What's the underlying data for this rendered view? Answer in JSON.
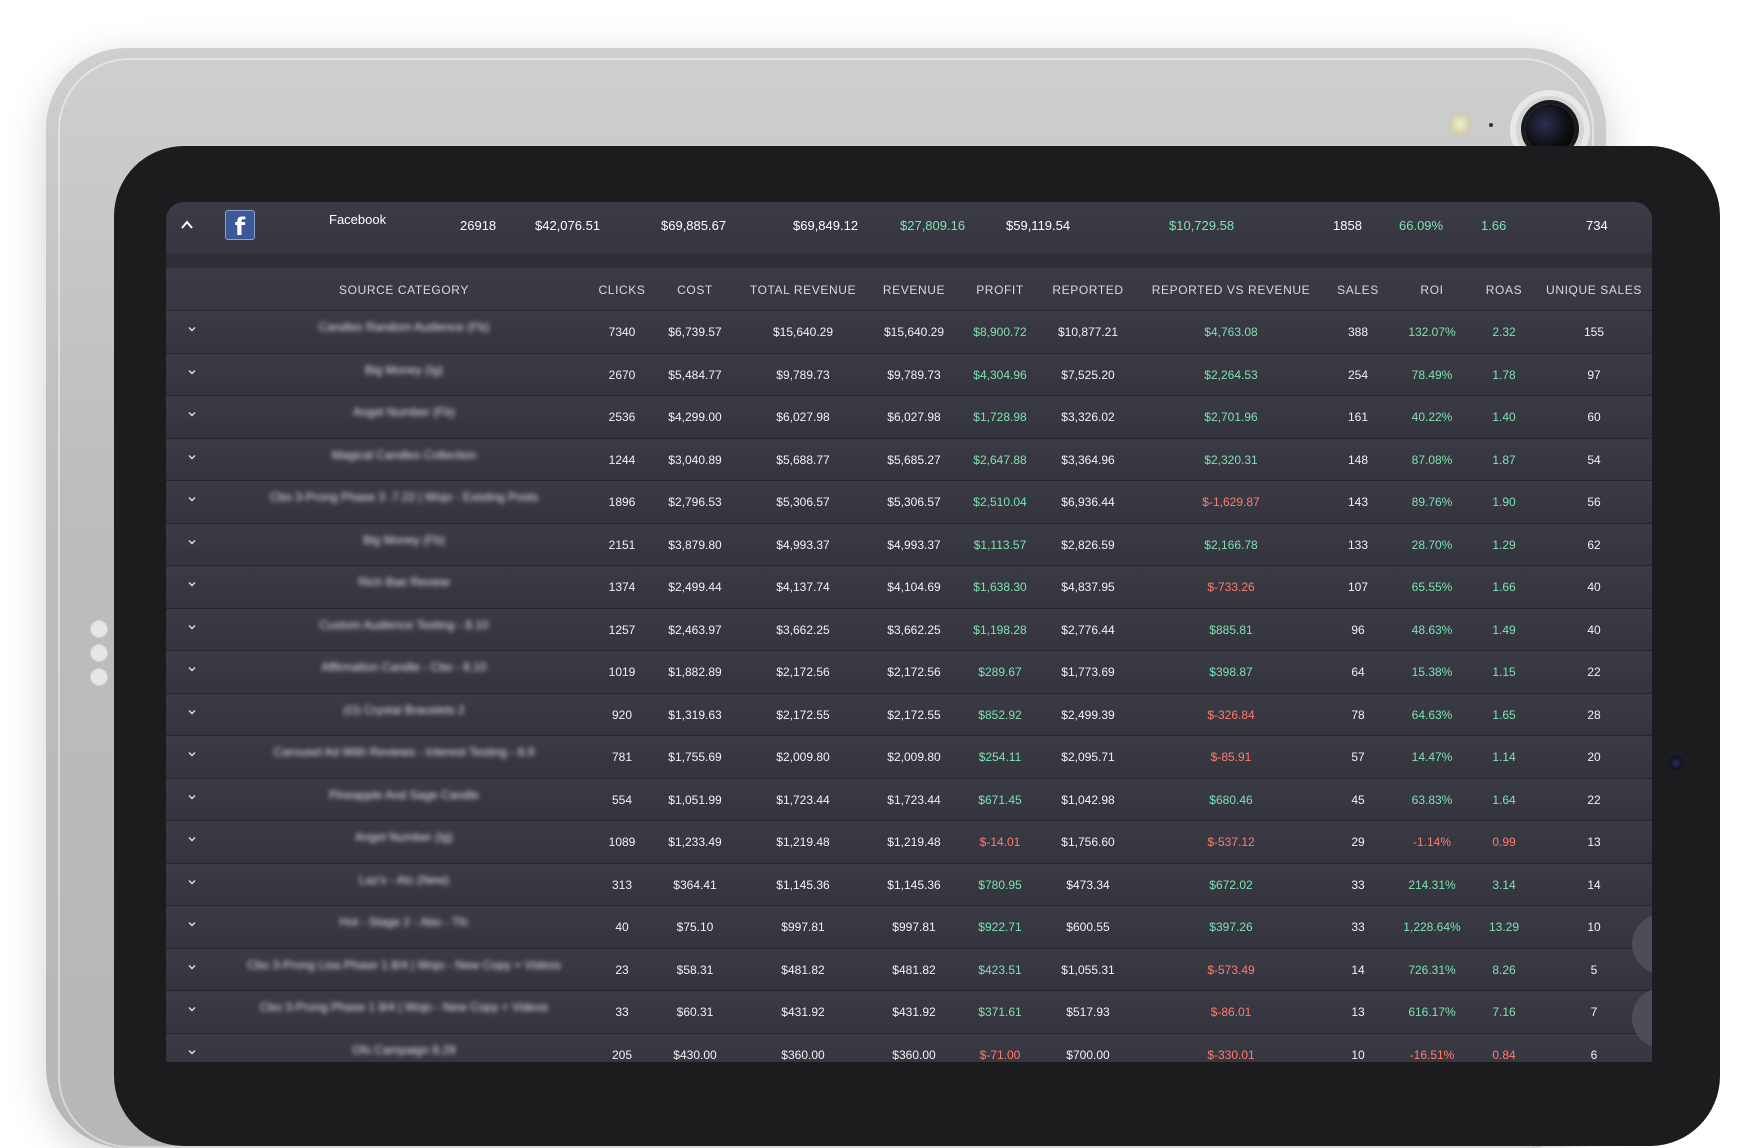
{
  "summary": {
    "source": "Facebook",
    "clicks": "26918",
    "cost": "$42,076.51",
    "total_revenue": "$69,885.67",
    "revenue": "$69,849.12",
    "profit": "$27,809.16",
    "reported": "$59,119.54",
    "reported_vs_revenue": "$10,729.58",
    "sales": "1858",
    "roi": "66.09%",
    "roas": "1.66",
    "unique_sales": "734"
  },
  "columns": {
    "source_category": "SOURCE CATEGORY",
    "clicks": "CLICKS",
    "cost": "COST",
    "total_revenue": "TOTAL REVENUE",
    "revenue": "REVENUE",
    "profit": "PROFIT",
    "reported": "REPORTED",
    "reported_vs_revenue": "REPORTED VS REVENUE",
    "sales": "SALES",
    "roi": "ROI",
    "roas": "ROAS",
    "unique_sales": "UNIQUE SALES"
  },
  "rows": [
    {
      "name": "Candles Random Audience (Fb)",
      "clicks": "7340",
      "cost": "$6,739.57",
      "total_revenue": "$15,640.29",
      "revenue": "$15,640.29",
      "profit": "$8,900.72",
      "reported": "$10,877.21",
      "rvr": "$4,763.08",
      "sales": "388",
      "roi": "132.07%",
      "roas": "2.32",
      "unique": "155"
    },
    {
      "name": "Big Money (Ig)",
      "clicks": "2670",
      "cost": "$5,484.77",
      "total_revenue": "$9,789.73",
      "revenue": "$9,789.73",
      "profit": "$4,304.96",
      "reported": "$7,525.20",
      "rvr": "$2,264.53",
      "sales": "254",
      "roi": "78.49%",
      "roas": "1.78",
      "unique": "97"
    },
    {
      "name": "Angel Number (Fb)",
      "clicks": "2536",
      "cost": "$4,299.00",
      "total_revenue": "$6,027.98",
      "revenue": "$6,027.98",
      "profit": "$1,728.98",
      "reported": "$3,326.02",
      "rvr": "$2,701.96",
      "sales": "161",
      "roi": "40.22%",
      "roas": "1.40",
      "unique": "60"
    },
    {
      "name": "Magical Candles Collection",
      "clicks": "1244",
      "cost": "$3,040.89",
      "total_revenue": "$5,688.77",
      "revenue": "$5,685.27",
      "profit": "$2,647.88",
      "reported": "$3,364.96",
      "rvr": "$2,320.31",
      "sales": "148",
      "roi": "87.08%",
      "roas": "1.87",
      "unique": "54"
    },
    {
      "name": "Cbo 3-Prong Phase 3 .7.22 | Wojo - Existing Posts",
      "clicks": "1896",
      "cost": "$2,796.53",
      "total_revenue": "$5,306.57",
      "revenue": "$5,306.57",
      "profit": "$2,510.04",
      "reported": "$6,936.44",
      "rvr": "$-1,629.87",
      "sales": "143",
      "roi": "89.76%",
      "roas": "1.90",
      "unique": "56"
    },
    {
      "name": "Big Money (Fb)",
      "clicks": "2151",
      "cost": "$3,879.80",
      "total_revenue": "$4,993.37",
      "revenue": "$4,993.37",
      "profit": "$1,113.57",
      "reported": "$2,826.59",
      "rvr": "$2,166.78",
      "sales": "133",
      "roi": "28.70%",
      "roas": "1.29",
      "unique": "62"
    },
    {
      "name": "Rich Bae Review",
      "clicks": "1374",
      "cost": "$2,499.44",
      "total_revenue": "$4,137.74",
      "revenue": "$4,104.69",
      "profit": "$1,638.30",
      "reported": "$4,837.95",
      "rvr": "$-733.26",
      "sales": "107",
      "roi": "65.55%",
      "roas": "1.66",
      "unique": "40"
    },
    {
      "name": "Custom Audience Testing - 8.10",
      "clicks": "1257",
      "cost": "$2,463.97",
      "total_revenue": "$3,662.25",
      "revenue": "$3,662.25",
      "profit": "$1,198.28",
      "reported": "$2,776.44",
      "rvr": "$885.81",
      "sales": "96",
      "roi": "48.63%",
      "roas": "1.49",
      "unique": "40"
    },
    {
      "name": "Affirmation Candle - Cbo - 8.10",
      "clicks": "1019",
      "cost": "$1,882.89",
      "total_revenue": "$2,172.56",
      "revenue": "$2,172.56",
      "profit": "$289.67",
      "reported": "$1,773.69",
      "rvr": "$398.87",
      "sales": "64",
      "roi": "15.38%",
      "roas": "1.15",
      "unique": "22"
    },
    {
      "name": "(O) Crystal Bracelets 2",
      "clicks": "920",
      "cost": "$1,319.63",
      "total_revenue": "$2,172.55",
      "revenue": "$2,172.55",
      "profit": "$852.92",
      "reported": "$2,499.39",
      "rvr": "$-326.84",
      "sales": "78",
      "roi": "64.63%",
      "roas": "1.65",
      "unique": "28"
    },
    {
      "name": "Carousel Ad With Reviews - Interest Testing - 8.9",
      "clicks": "781",
      "cost": "$1,755.69",
      "total_revenue": "$2,009.80",
      "revenue": "$2,009.80",
      "profit": "$254.11",
      "reported": "$2,095.71",
      "rvr": "$-85.91",
      "sales": "57",
      "roi": "14.47%",
      "roas": "1.14",
      "unique": "20"
    },
    {
      "name": "Pineapple And Sage Candle",
      "clicks": "554",
      "cost": "$1,051.99",
      "total_revenue": "$1,723.44",
      "revenue": "$1,723.44",
      "profit": "$671.45",
      "reported": "$1,042.98",
      "rvr": "$680.46",
      "sales": "45",
      "roi": "63.83%",
      "roas": "1.64",
      "unique": "22"
    },
    {
      "name": "Angel Number (Ig)",
      "clicks": "1089",
      "cost": "$1,233.49",
      "total_revenue": "$1,219.48",
      "revenue": "$1,219.48",
      "profit": "$-14.01",
      "reported": "$1,756.60",
      "rvr": "$-537.12",
      "sales": "29",
      "roi": "-1.14%",
      "roas": "0.99",
      "unique": "13"
    },
    {
      "name": "Laz's - Atc (New)",
      "clicks": "313",
      "cost": "$364.41",
      "total_revenue": "$1,145.36",
      "revenue": "$1,145.36",
      "profit": "$780.95",
      "reported": "$473.34",
      "rvr": "$672.02",
      "sales": "33",
      "roi": "214.31%",
      "roas": "3.14",
      "unique": "14"
    },
    {
      "name": "Hot - Stage 2 - Abo - Tfc",
      "clicks": "40",
      "cost": "$75.10",
      "total_revenue": "$997.81",
      "revenue": "$997.81",
      "profit": "$922.71",
      "reported": "$600.55",
      "rvr": "$397.26",
      "sales": "33",
      "roi": "1,228.64%",
      "roas": "13.29",
      "unique": "10"
    },
    {
      "name": "Cbo 3-Prong Lisa Phase 1.8/4 | Wojo - New Copy + Videos",
      "clicks": "23",
      "cost": "$58.31",
      "total_revenue": "$481.82",
      "revenue": "$481.82",
      "profit": "$423.51",
      "reported": "$1,055.31",
      "rvr": "$-573.49",
      "sales": "14",
      "roi": "726.31%",
      "roas": "8.26",
      "unique": "5"
    },
    {
      "name": "Cbo 3-Prong Phase 1 8/4 | Wojo - New Copy + Videos",
      "clicks": "33",
      "cost": "$60.31",
      "total_revenue": "$431.92",
      "revenue": "$431.92",
      "profit": "$371.61",
      "reported": "$517.93",
      "rvr": "$-86.01",
      "sales": "13",
      "roi": "616.17%",
      "roas": "7.16",
      "unique": "7"
    },
    {
      "name": "Ofs Campaign 8.29",
      "clicks": "205",
      "cost": "$430.00",
      "total_revenue": "$360.00",
      "revenue": "$360.00",
      "profit": "$-71.00",
      "reported": "$700.00",
      "rvr": "$-330.01",
      "sales": "10",
      "roi": "-16.51%",
      "roas": "0.84",
      "unique": "6"
    }
  ],
  "colors": {
    "positive": "#7de3b0",
    "negative": "#ff7b6b",
    "facebook": "#3b5998"
  },
  "icons": {
    "collapse": "chevron-up-icon",
    "expand": "chevron-down-icon",
    "source": "facebook-icon"
  }
}
